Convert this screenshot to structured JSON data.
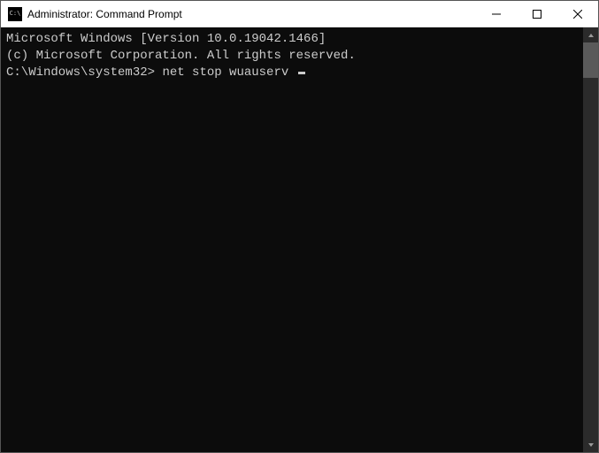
{
  "window": {
    "title": "Administrator: Command Prompt"
  },
  "terminal": {
    "line1": "Microsoft Windows [Version 10.0.19042.1466]",
    "line2": "(c) Microsoft Corporation. All rights reserved.",
    "blank": "",
    "prompt": "C:\\Windows\\system32>",
    "command": "net stop wuauserv"
  }
}
